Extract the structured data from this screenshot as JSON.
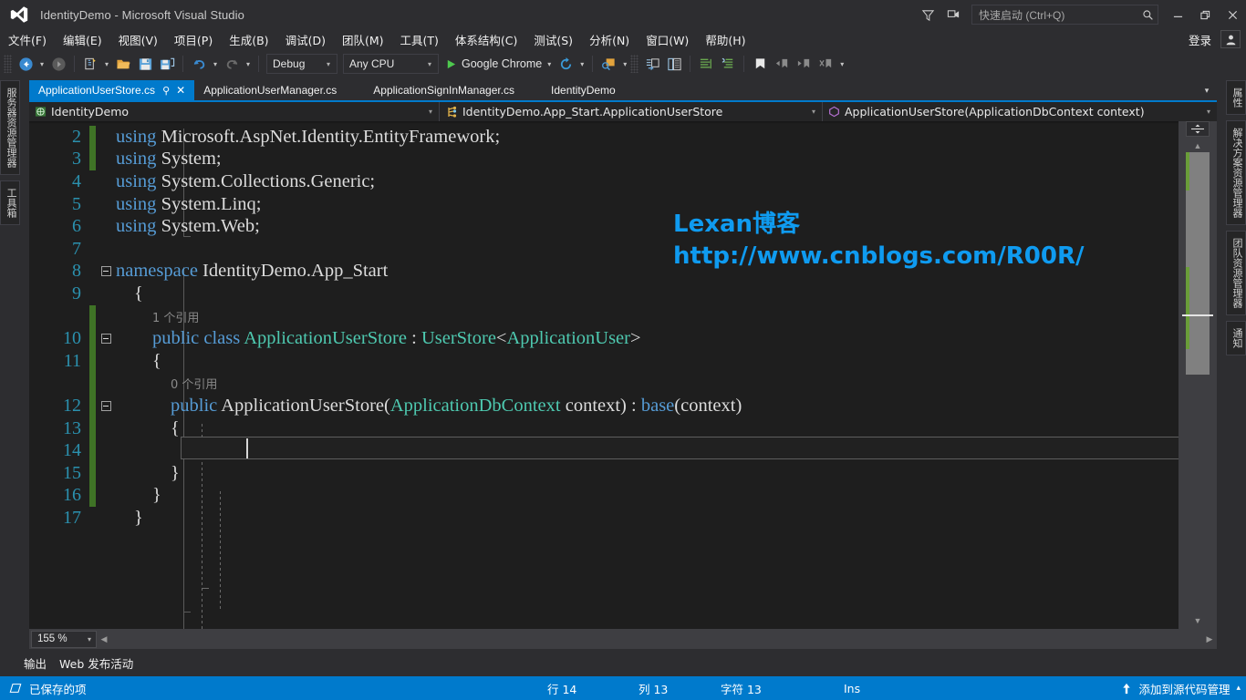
{
  "titlebar": {
    "logo_icon": "visual-studio-logo",
    "title": "IdentityDemo - Microsoft Visual Studio",
    "feedback_icon": "feedback-funnel-icon",
    "screenshot_icon": "send-a-smile-icon",
    "quick_launch": {
      "placeholder": "快速启动 (Ctrl+Q)",
      "search_icon": "search-icon"
    },
    "minimize": "—",
    "restore": "❐",
    "close": "✕"
  },
  "menubar": {
    "items": [
      {
        "label": "文件(F)"
      },
      {
        "label": "编辑(E)"
      },
      {
        "label": "视图(V)"
      },
      {
        "label": "项目(P)"
      },
      {
        "label": "生成(B)"
      },
      {
        "label": "调试(D)"
      },
      {
        "label": "团队(M)"
      },
      {
        "label": "工具(T)"
      },
      {
        "label": "体系结构(C)"
      },
      {
        "label": "测试(S)"
      },
      {
        "label": "分析(N)"
      },
      {
        "label": "窗口(W)"
      },
      {
        "label": "帮助(H)"
      }
    ],
    "signin": "登录",
    "account_icon": "account-avatar-icon"
  },
  "toolbar": {
    "nav_back_icon": "navigate-back-icon",
    "nav_forward_icon": "navigate-forward-icon",
    "new_project_icon": "new-project-icon",
    "open_file_icon": "open-file-icon",
    "save_icon": "save-icon",
    "save_all_icon": "save-all-icon",
    "undo_icon": "undo-icon",
    "redo_icon": "redo-icon",
    "config_combo": {
      "value": "Debug"
    },
    "platform_combo": {
      "value": "Any CPU"
    },
    "run_label": "Google Chrome",
    "run_icon": "play-icon",
    "refresh_icon": "refresh-icon",
    "find_in_files_icon": "find-in-files-icon",
    "step_icon": "step-into-icon",
    "properties_icon": "properties-window-icon",
    "comment_icon": "comment-lines-icon",
    "uncomment_icon": "uncomment-lines-icon",
    "bookmark_icon": "toggle-bookmark-icon",
    "prev_bookmark_icon": "previous-bookmark-icon",
    "next_bookmark_icon": "next-bookmark-icon",
    "clear_bookmark_icon": "clear-bookmarks-icon",
    "overflow_icon": "toolbar-overflow-icon"
  },
  "left_dock": {
    "tabs": [
      {
        "label": "服务器资源管理器"
      },
      {
        "label": "工具箱"
      }
    ]
  },
  "right_dock": {
    "tabs": [
      {
        "label": "属性"
      },
      {
        "label": "解决方案资源管理器"
      },
      {
        "label": "团队资源管理器"
      },
      {
        "label": "通知"
      }
    ]
  },
  "editor_tabs": {
    "tabs": [
      {
        "label": "ApplicationUserStore.cs",
        "active": true,
        "pin_icon": "pin-icon",
        "close_icon": "close-icon"
      },
      {
        "label": "ApplicationUserManager.cs",
        "active": false
      },
      {
        "label": "ApplicationSignInManager.cs",
        "active": false
      },
      {
        "label": "IdentityDemo",
        "active": false
      }
    ],
    "overflow_caret": "▾"
  },
  "navbar": {
    "project": {
      "icon": "project-icon",
      "label": "IdentityDemo",
      "caret": "▾"
    },
    "type": {
      "icon": "class-icon",
      "label": "IdentityDemo.App_Start.ApplicationUserStore",
      "caret": "▾"
    },
    "member": {
      "icon": "method-icon",
      "label": "ApplicationUserStore(ApplicationDbContext context)",
      "caret": "▾"
    }
  },
  "editor": {
    "watermark": {
      "line1": "Lexan博客",
      "line2": "http://www.cnblogs.com/R00R/",
      "color": "#0f9bf0"
    },
    "codelens": {
      "class_refs": "1 个引用",
      "ctor_refs": "0 个引用"
    },
    "lines": [
      {
        "num": "2",
        "saved": true,
        "fold": "",
        "indent": 0,
        "tokens": [
          {
            "t": "using ",
            "c": "k"
          },
          {
            "t": "Microsoft.AspNet.Identity.EntityFramework;",
            "c": "p"
          }
        ]
      },
      {
        "num": "3",
        "saved": true,
        "fold": "",
        "indent": 0,
        "tokens": [
          {
            "t": "using ",
            "c": "k"
          },
          {
            "t": "System;",
            "c": "p"
          }
        ]
      },
      {
        "num": "4",
        "saved": false,
        "fold": "",
        "indent": 0,
        "tokens": [
          {
            "t": "using ",
            "c": "k"
          },
          {
            "t": "System.Collections.Generic;",
            "c": "p"
          }
        ]
      },
      {
        "num": "5",
        "saved": false,
        "fold": "",
        "indent": 0,
        "tokens": [
          {
            "t": "using ",
            "c": "k"
          },
          {
            "t": "System.Linq;",
            "c": "p"
          }
        ]
      },
      {
        "num": "6",
        "saved": false,
        "fold": "",
        "indent": 0,
        "tokens": [
          {
            "t": "using ",
            "c": "k"
          },
          {
            "t": "System.Web;",
            "c": "p"
          }
        ]
      },
      {
        "num": "7",
        "saved": false,
        "fold": "",
        "indent": 0,
        "tokens": []
      },
      {
        "num": "8",
        "saved": false,
        "fold": "minus",
        "indent": 0,
        "tokens": [
          {
            "t": "namespace ",
            "c": "k"
          },
          {
            "t": "IdentityDemo.App_Start",
            "c": "p"
          }
        ]
      },
      {
        "num": "9",
        "saved": false,
        "fold": "",
        "indent": 1,
        "tokens": [
          {
            "t": "{",
            "c": "p"
          }
        ]
      },
      {
        "num": "",
        "saved": true,
        "fold": "",
        "indent": 2,
        "codelens": "1 个引用"
      },
      {
        "num": "10",
        "saved": true,
        "fold": "minus",
        "indent": 2,
        "tokens": [
          {
            "t": "public class ",
            "c": "k"
          },
          {
            "t": "ApplicationUserStore",
            "c": "t"
          },
          {
            "t": " : ",
            "c": "p"
          },
          {
            "t": "UserStore",
            "c": "t"
          },
          {
            "t": "<",
            "c": "p"
          },
          {
            "t": "ApplicationUser",
            "c": "t"
          },
          {
            "t": ">",
            "c": "p"
          }
        ]
      },
      {
        "num": "11",
        "saved": true,
        "fold": "",
        "indent": 2,
        "tokens": [
          {
            "t": "{",
            "c": "p"
          }
        ]
      },
      {
        "num": "",
        "saved": true,
        "fold": "",
        "indent": 3,
        "codelens": "0 个引用"
      },
      {
        "num": "12",
        "saved": true,
        "fold": "minus",
        "indent": 3,
        "tokens": [
          {
            "t": "public ",
            "c": "k"
          },
          {
            "t": "ApplicationUserStore(",
            "c": "p"
          },
          {
            "t": "ApplicationDbContext",
            "c": "t"
          },
          {
            "t": " context) : ",
            "c": "p"
          },
          {
            "t": "base",
            "c": "k"
          },
          {
            "t": "(context)",
            "c": "p"
          }
        ]
      },
      {
        "num": "13",
        "saved": true,
        "fold": "",
        "indent": 3,
        "tokens": [
          {
            "t": "{",
            "c": "p"
          }
        ]
      },
      {
        "num": "14",
        "saved": true,
        "fold": "",
        "indent": 4,
        "current": true,
        "tokens": []
      },
      {
        "num": "15",
        "saved": true,
        "fold": "",
        "indent": 3,
        "tokens": [
          {
            "t": "}",
            "c": "p"
          }
        ]
      },
      {
        "num": "16",
        "saved": true,
        "fold": "",
        "indent": 2,
        "tokens": [
          {
            "t": "}",
            "c": "p"
          }
        ]
      },
      {
        "num": "17",
        "saved": false,
        "fold": "",
        "indent": 1,
        "tokens": [
          {
            "t": "}",
            "c": "p"
          }
        ]
      }
    ]
  },
  "hbar": {
    "zoom": {
      "value": "155 %",
      "caret": "▾"
    },
    "scroll_left_icon": "scroll-left-arrow-icon",
    "scroll_right_icon": "scroll-right-arrow-icon"
  },
  "bottom_tabs": {
    "tabs": [
      {
        "label": "输出"
      },
      {
        "label": "Web 发布活动"
      }
    ]
  },
  "statusbar": {
    "saved_icon": "saved-item-icon",
    "saved_text": "已保存的项",
    "line_label": "行 14",
    "col_label": "列 13",
    "char_label": "字符 13",
    "insert_mode": "Ins",
    "source_control_icon": "upload-arrow-icon",
    "source_control_text": "添加到源代码管理",
    "source_control_caret": "▴",
    "accent_color": "#007acc"
  }
}
